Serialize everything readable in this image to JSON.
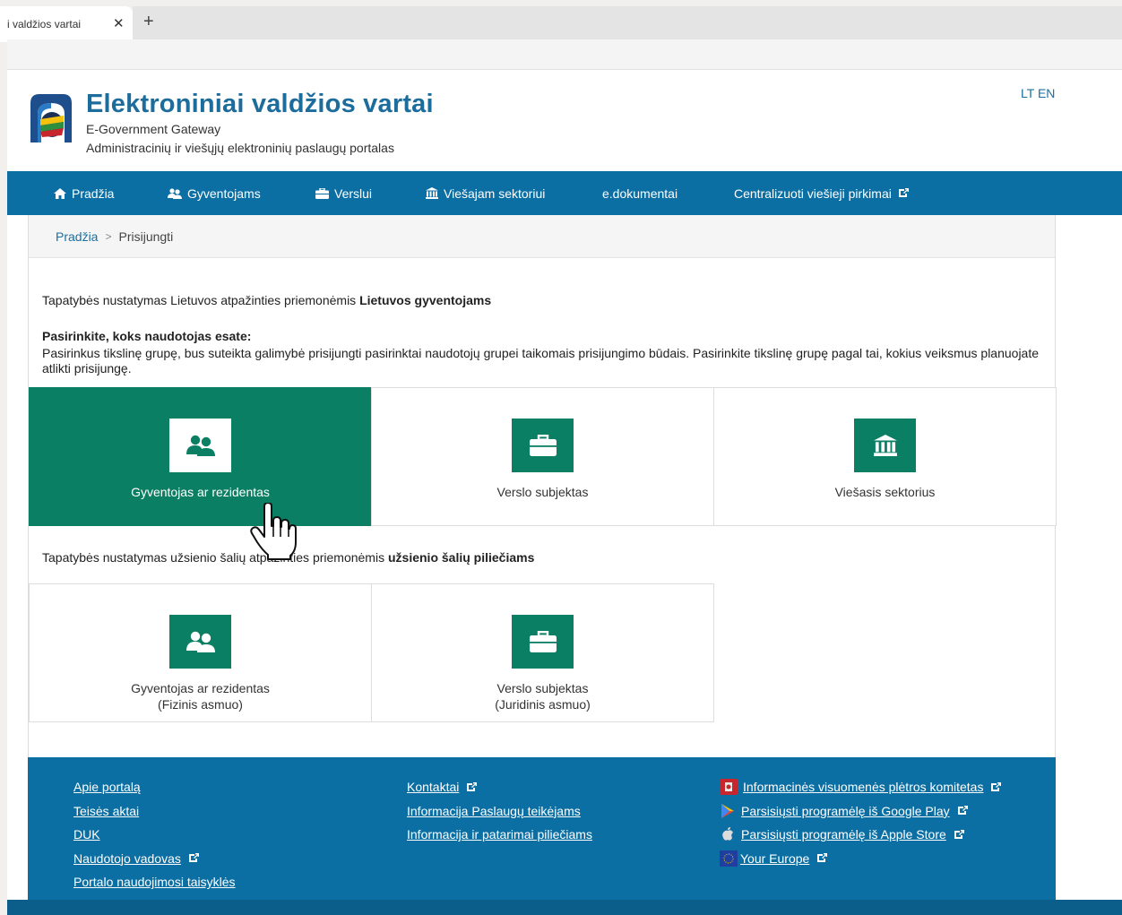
{
  "browser": {
    "tab_title": "i valdžios vartai",
    "tab_close": "✕",
    "new_tab": "+"
  },
  "header": {
    "lang_lt": "LT",
    "lang_en": "EN",
    "title": "Elektroniniai valdžios vartai",
    "subtitle": "E-Government Gateway",
    "tagline": "Administracinių ir viešųjų elektroninių paslaugų portalas"
  },
  "nav": {
    "items": [
      {
        "label": "Pradžia",
        "icon": "home-icon"
      },
      {
        "label": "Gyventojams",
        "icon": "people-icon"
      },
      {
        "label": "Verslui",
        "icon": "briefcase-icon"
      },
      {
        "label": "Viešajam sektoriui",
        "icon": "institution-icon"
      },
      {
        "label": "e.dokumentai",
        "icon": ""
      },
      {
        "label": "Centralizuoti viešieji pirkimai",
        "icon": "external-link-icon"
      }
    ]
  },
  "breadcrumb": {
    "home": "Pradžia",
    "separator": ">",
    "current": "Prisijungti"
  },
  "main": {
    "intro_lt_prefix": "Tapatybės nustatymas Lietuvos atpažinties priemonėmis",
    "intro_lt_bold": "Lietuvos gyventojams",
    "choose_heading": "Pasirinkite, koks naudotojas esate:",
    "choose_desc": "Pasirinkus tikslinę grupę, bus suteikta galimybė prisijungti pasirinktai naudotojų grupei taikomais prisijungimo būdais. Pasirinkite tikslinę grupę pagal tai, kokius veiksmus planuojate atlikti prisijungę.",
    "lt_cards": [
      {
        "label": "Gyventojas ar rezidentas",
        "icon": "people-icon",
        "active": true
      },
      {
        "label": "Verslo subjektas",
        "icon": "briefcase-icon",
        "active": false
      },
      {
        "label": "Viešasis sektorius",
        "icon": "institution-icon",
        "active": false
      }
    ],
    "intro_foreign_prefix": "Tapatybės nustatymas užsienio šalių atpažinties priemonėmis",
    "intro_foreign_bold": "užsienio šalių piliečiams",
    "foreign_cards": [
      {
        "label": "Gyventojas ar rezidentas",
        "label2": "(Fizinis asmuo)",
        "icon": "people-icon"
      },
      {
        "label": "Verslo subjektas",
        "label2": "(Juridinis asmuo)",
        "icon": "briefcase-icon"
      }
    ]
  },
  "footer": {
    "col1": [
      "Apie portalą",
      "Teisės aktai",
      "DUK",
      "Naudotojo vadovas",
      "Portalo naudojimosi taisyklės"
    ],
    "col2": [
      "Kontaktai",
      "Informacija Paslaugų teikėjams",
      "Informacija ir patarimai piliečiams"
    ],
    "col3": [
      "Informacinės visuomenės plėtros komitetas",
      "Parsisiųsti programėlę iš Google Play",
      "Parsisiųsti programėlę iš Apple Store",
      "Your Europe"
    ]
  },
  "colors": {
    "brand_blue": "#0b6fa4",
    "brand_green": "#0a7f63"
  }
}
